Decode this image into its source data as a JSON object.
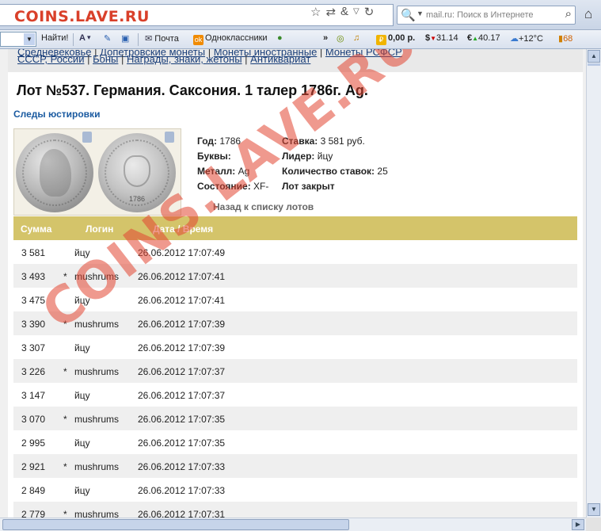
{
  "address_bar": {
    "site_title": "COINS.LAVE.RU",
    "search_placeholder": "mail.ru: Поиск в Интернете"
  },
  "toolbar": {
    "find_label": "Найти!",
    "mail_label": "Почта",
    "ok_label": "Одноклассники",
    "overflow": "»",
    "balance": "0,00 р.",
    "usd_rate": "31.14",
    "eur_rate": "40.17",
    "weather": "+12°C",
    "traffic": "68"
  },
  "nav": {
    "line1_items": [
      "Средневековье",
      "Допетровские монеты",
      "Монеты иностранные",
      "Монеты РСФСР"
    ],
    "line2_items": [
      "СССР, России",
      "Боны",
      "Награды, знаки, жетоны",
      "Антиквариат"
    ]
  },
  "lot": {
    "title": "Лот №537.  Германия. Саксония. 1 талер 1786г. Ag.",
    "subtitle": "Следы юстировки",
    "coin_year": "1786",
    "year_label": "Год:",
    "year_value": "1786",
    "letters_label": "Буквы:",
    "letters_value": "",
    "metal_label": "Металл:",
    "metal_value": "Ag",
    "condition_label": "Состояние:",
    "condition_value": "XF-",
    "bid_label": "Ставка:",
    "bid_value": "3 581 руб.",
    "leader_label": "Лидер:",
    "leader_value": "йцу",
    "count_label": "Количество ставок:",
    "count_value": "25",
    "status": "Лот закрыт",
    "back_link": "Назад к списку лотов"
  },
  "bids_table": {
    "headers": [
      "Сумма",
      "Логин",
      "Дата / Время"
    ],
    "rows": [
      {
        "sum": "3 581",
        "mark": "",
        "login": "йцу",
        "datetime": "26.06.2012 17:07:49"
      },
      {
        "sum": "3 493",
        "mark": "*",
        "login": "mushrums",
        "datetime": "26.06.2012 17:07:41"
      },
      {
        "sum": "3 475",
        "mark": "",
        "login": "йцу",
        "datetime": "26.06.2012 17:07:41"
      },
      {
        "sum": "3 390",
        "mark": "*",
        "login": "mushrums",
        "datetime": "26.06.2012 17:07:39"
      },
      {
        "sum": "3 307",
        "mark": "",
        "login": "йцу",
        "datetime": "26.06.2012 17:07:39"
      },
      {
        "sum": "3 226",
        "mark": "*",
        "login": "mushrums",
        "datetime": "26.06.2012 17:07:37"
      },
      {
        "sum": "3 147",
        "mark": "",
        "login": "йцу",
        "datetime": "26.06.2012 17:07:37"
      },
      {
        "sum": "3 070",
        "mark": "*",
        "login": "mushrums",
        "datetime": "26.06.2012 17:07:35"
      },
      {
        "sum": "2 995",
        "mark": "",
        "login": "йцу",
        "datetime": "26.06.2012 17:07:35"
      },
      {
        "sum": "2 921",
        "mark": "*",
        "login": "mushrums",
        "datetime": "26.06.2012 17:07:33"
      },
      {
        "sum": "2 849",
        "mark": "",
        "login": "йцу",
        "datetime": "26.06.2012 17:07:33"
      },
      {
        "sum": "2 779",
        "mark": "*",
        "login": "mushrums",
        "datetime": "26.06.2012 17:07:31"
      }
    ]
  },
  "watermark": "COINS.LAVE.RU",
  "colors": {
    "table_header": "#d4c46a",
    "alt_row": "#efefef",
    "link": "#1a5aa0",
    "watermark": "#e14632"
  }
}
